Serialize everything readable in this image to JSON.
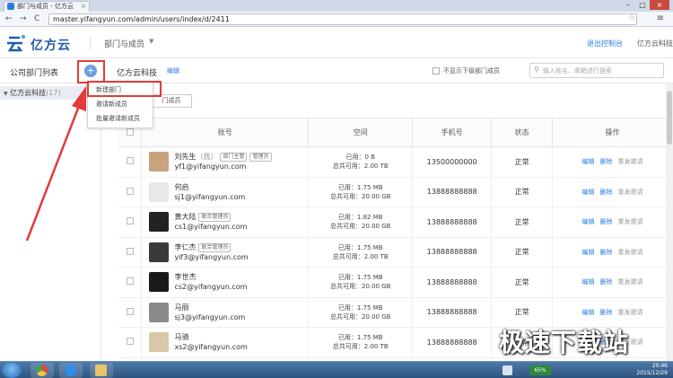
{
  "browser": {
    "tab_title": "部门与成员 - 亿方云",
    "close_tab": "×",
    "window_controls": [
      "–",
      "□",
      "×"
    ],
    "back": "←",
    "forward": "→",
    "reload": "C",
    "url": "master.yifangyun.com/admin/users/index/d/2411",
    "star": "☆",
    "menu": "≡"
  },
  "header": {
    "brand": "亿方云",
    "nav_title": "部门与成员",
    "nav_caret": "▼",
    "exit_console": "退出控制台",
    "org_name": "亿方云科技"
  },
  "toolbar": {
    "title": "公司部门列表",
    "plus": "+",
    "current_org": "亿方云科技",
    "edit": "编辑",
    "hide_sub_label": "不显示下级部门成员",
    "search_placeholder": "输入姓名、邮箱进行搜索",
    "search_icon": "⚲"
  },
  "sidebar": {
    "items": [
      {
        "label": "亿方云科技",
        "count": "(17)",
        "arrow": "▼"
      }
    ]
  },
  "dropdown": {
    "items": [
      "新建部门",
      "邀请新成员",
      "批量邀请新成员"
    ]
  },
  "main": {
    "move_btn": "门成员",
    "columns": [
      "账号",
      "空间",
      "手机号",
      "状态",
      "操作"
    ],
    "ops": {
      "edit": "编辑",
      "delete": "删除",
      "reinvite": "重发邀请"
    },
    "rows": [
      {
        "name": "刘先生",
        "me": "（我）",
        "badges": [
          "部门主管",
          "管理员"
        ],
        "email": "yf1@yifangyun.com",
        "used": "已用：0 B",
        "total": "总共可用：2.00 TB",
        "phone": "13500000000",
        "status": "正常",
        "avatar_color": "#c9a27e"
      },
      {
        "name": "何启",
        "me": "",
        "badges": [],
        "email": "sj1@yifangyun.com",
        "used": "已用：1.75 MB",
        "total": "总共可用：20.00 GB",
        "phone": "13888888888",
        "status": "正常",
        "avatar_color": "#e8e8e8"
      },
      {
        "name": "黄大陆",
        "me": "",
        "badges": [
          "联合管理员"
        ],
        "email": "cs1@yifangyun.com",
        "used": "已用：1.82 MB",
        "total": "总共可用：20.00 GB",
        "phone": "13888888888",
        "status": "正常",
        "avatar_color": "#222222"
      },
      {
        "name": "李仁杰",
        "me": "",
        "badges": [
          "联合管理员"
        ],
        "email": "yif3@yifangyun.com",
        "used": "已用：1.75 MB",
        "total": "总共可用：2.00 TB",
        "phone": "13888888888",
        "status": "正常",
        "avatar_color": "#3a3a3a"
      },
      {
        "name": "李世杰",
        "me": "",
        "badges": [],
        "email": "cs2@yifangyun.com",
        "used": "已用：1.75 MB",
        "total": "总共可用：20.00 GB",
        "phone": "13888888888",
        "status": "正常",
        "avatar_color": "#1a1a1a"
      },
      {
        "name": "马丽",
        "me": "",
        "badges": [],
        "email": "sj3@yifangyun.com",
        "used": "已用：1.75 MB",
        "total": "总共可用：20.00 GB",
        "phone": "13888888888",
        "status": "正常",
        "avatar_color": "#8a8a8a"
      },
      {
        "name": "马骑",
        "me": "",
        "badges": [],
        "email": "xs2@yifangyun.com",
        "used": "已用：1.75 MB",
        "total": "总共可用：2.00 TB",
        "phone": "13888888888",
        "status": "正常",
        "avatar_color": "#d8c8a8"
      }
    ]
  },
  "taskbar": {
    "battery": "65%",
    "time": "20:46",
    "date": "2015/12/29"
  },
  "watermark": "极速下载站",
  "colors": {
    "accent": "#2b7de1",
    "annotation_red": "#e33a3a",
    "brand": "#1e5ca8"
  }
}
